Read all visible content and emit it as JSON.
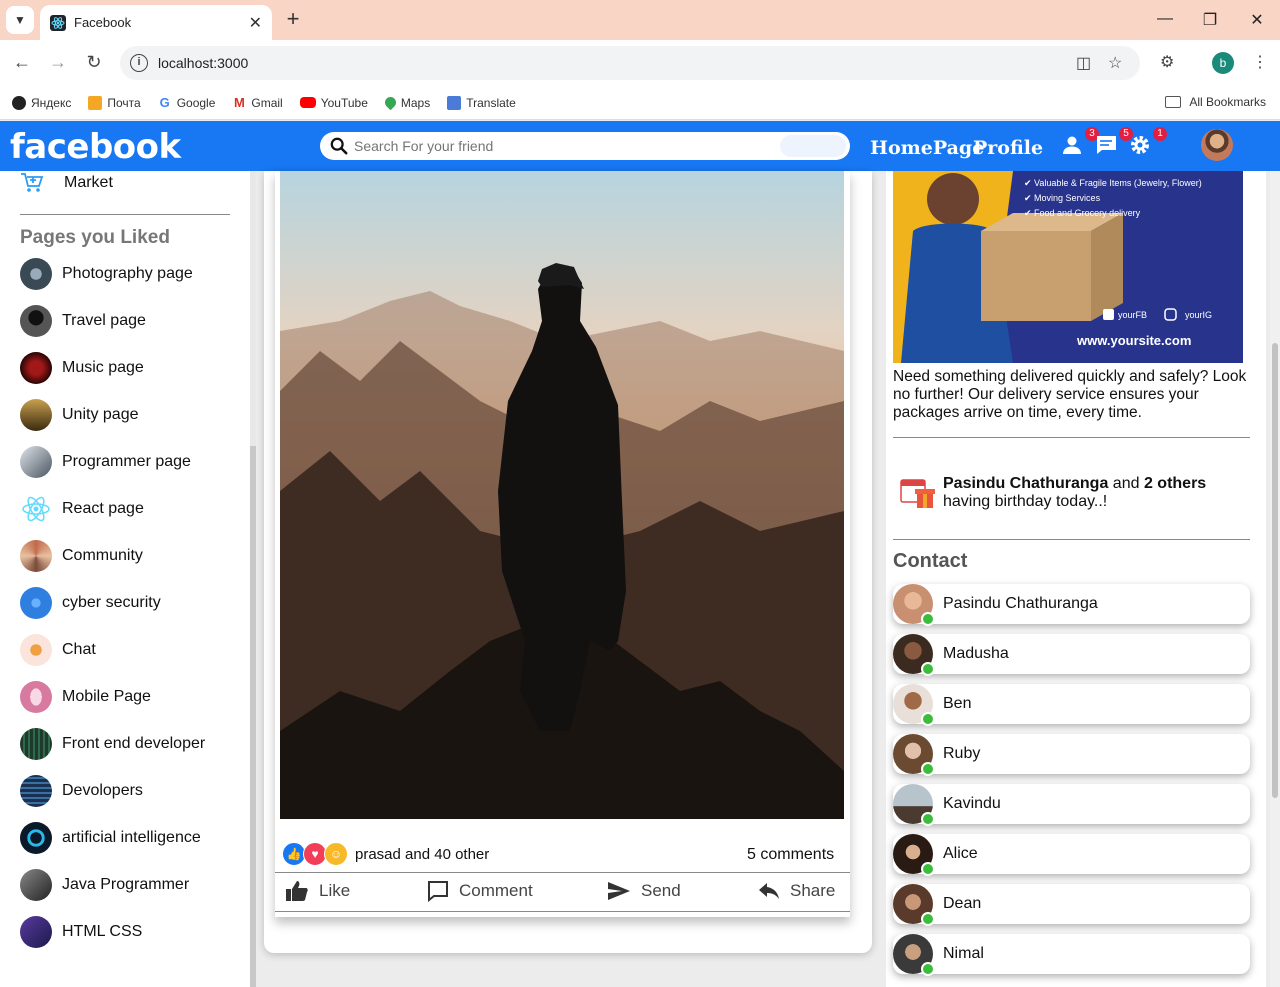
{
  "browser": {
    "tab_title": "Facebook",
    "url": "localhost:3000",
    "profile_initial": "b",
    "bookmarks": [
      {
        "label": "Яндекс",
        "color": "#222222"
      },
      {
        "label": "Почта",
        "color": "#f5a623"
      },
      {
        "label": "Google",
        "color": "#4285f4"
      },
      {
        "label": "Gmail",
        "color": "#d93025"
      },
      {
        "label": "YouTube",
        "color": "#ff0000"
      },
      {
        "label": "Maps",
        "color": "#34a853"
      },
      {
        "label": "Translate",
        "color": "#4a7bd8"
      }
    ],
    "all_bookmarks": "All Bookmarks"
  },
  "fb": {
    "logo": "facebook",
    "search_placeholder": "Search For your friend",
    "nav": {
      "home": "HomePage",
      "profile": "Profile"
    },
    "badges": {
      "friends": "3",
      "messages": "5",
      "notifications": "1"
    },
    "brand_color": "#1877f2"
  },
  "sidebar": {
    "market": "Market",
    "pages_heading": "Pages you Liked",
    "pages": [
      {
        "label": "Photography page",
        "color": "#3a4a55"
      },
      {
        "label": "Travel page",
        "color": "#2d2d2d"
      },
      {
        "label": "Music page",
        "color": "#5a0e0e"
      },
      {
        "label": "Unity page",
        "color": "#6b5a2a"
      },
      {
        "label": "Programmer page",
        "color": "#4a5560"
      },
      {
        "label": "React page",
        "color": "#61dafb"
      },
      {
        "label": "Community",
        "color": "#b07a5a"
      },
      {
        "label": "cyber security",
        "color": "#2f7fe0"
      },
      {
        "label": "Chat",
        "color": "#f2b8a8"
      },
      {
        "label": "Mobile Page",
        "color": "#d87aa0"
      },
      {
        "label": "Front end developer",
        "color": "#1e3a2e"
      },
      {
        "label": "Devolopers",
        "color": "#2c4a70"
      },
      {
        "label": "artificial intelligence",
        "color": "#0a1a2a"
      },
      {
        "label": "Java Programmer",
        "color": "#3a3a3a"
      },
      {
        "label": "HTML CSS",
        "color": "#3a2a7a"
      }
    ]
  },
  "post": {
    "reactions_text": "prasad and 40 other",
    "comments": "5 comments",
    "actions": {
      "like": "Like",
      "comment": "Comment",
      "send": "Send",
      "share": "Share"
    }
  },
  "right": {
    "ad": {
      "features": [
        "Valuable & Fragile Items (Jewelry, Flower)",
        "Moving Services",
        "Food and Grocery delivery"
      ],
      "social_fb": "yourFB",
      "social_ig": "yourIG",
      "site": "www.yoursite.com"
    },
    "ad_text": "Need something delivered quickly and safely? Look no further! Our delivery service ensures your packages arrive on time, every time.",
    "birthday": {
      "name": "Pasindu Chathuranga",
      "and": " and ",
      "others": "2 others",
      "suffix": "having birthday today..!"
    },
    "contact_heading": "Contact",
    "contacts": [
      {
        "name": "Pasindu Chathuranga",
        "color": "#c89070"
      },
      {
        "name": "Madusha",
        "color": "#3a2a20"
      },
      {
        "name": "Ben",
        "color": "#8a5a40"
      },
      {
        "name": "Ruby",
        "color": "#b08a70"
      },
      {
        "name": "Kavindu",
        "color": "#5a6a7a"
      },
      {
        "name": "Alice",
        "color": "#4a3a30"
      },
      {
        "name": "Dean",
        "color": "#6a4a3a"
      },
      {
        "name": "Nimal",
        "color": "#5a5a5a"
      }
    ]
  }
}
